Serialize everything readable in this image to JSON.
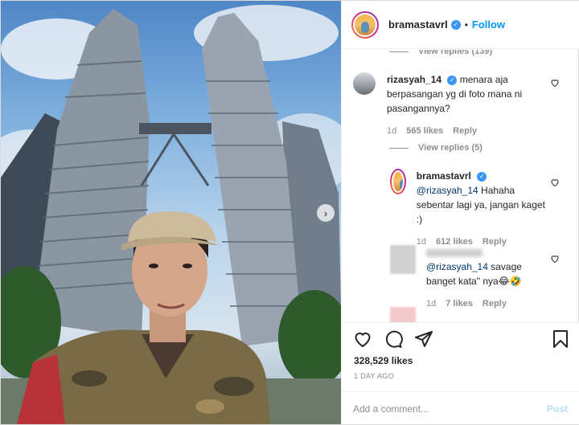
{
  "colors": {
    "accent": "#0095f6",
    "verified": "#3897f0",
    "muted": "#8e8e8e",
    "text": "#262626"
  },
  "header": {
    "username": "bramastavrl",
    "separator": "•",
    "follow_label": "Follow"
  },
  "photo": {
    "next_icon": "chevron-right-icon"
  },
  "comments": {
    "top_replies_label": "View replies (139)",
    "main": {
      "username": "rizasyah_14",
      "text": "menara aja berpasangan yg di foto mana ni pasangannya?",
      "age": "1d",
      "likes": "565 likes",
      "reply": "Reply"
    },
    "replies_label": "View replies (5)",
    "reply1": {
      "username": "bramastavrl",
      "mention": "@rizasyah_14",
      "text": " Hahaha sebentar lagi ya, jangan kaget :)",
      "age": "1d",
      "likes": "612 likes",
      "reply": "Reply"
    },
    "reply2": {
      "mention": "@rizasyah_14",
      "text": " savage banget kata\" nya😂🤣",
      "age": "1d",
      "likes": "7 likes",
      "reply": "Reply"
    }
  },
  "actions": {
    "likes": "328,529 likes",
    "date": "1 DAY AGO",
    "comment_placeholder": "Add a comment...",
    "post_label": "Post"
  }
}
